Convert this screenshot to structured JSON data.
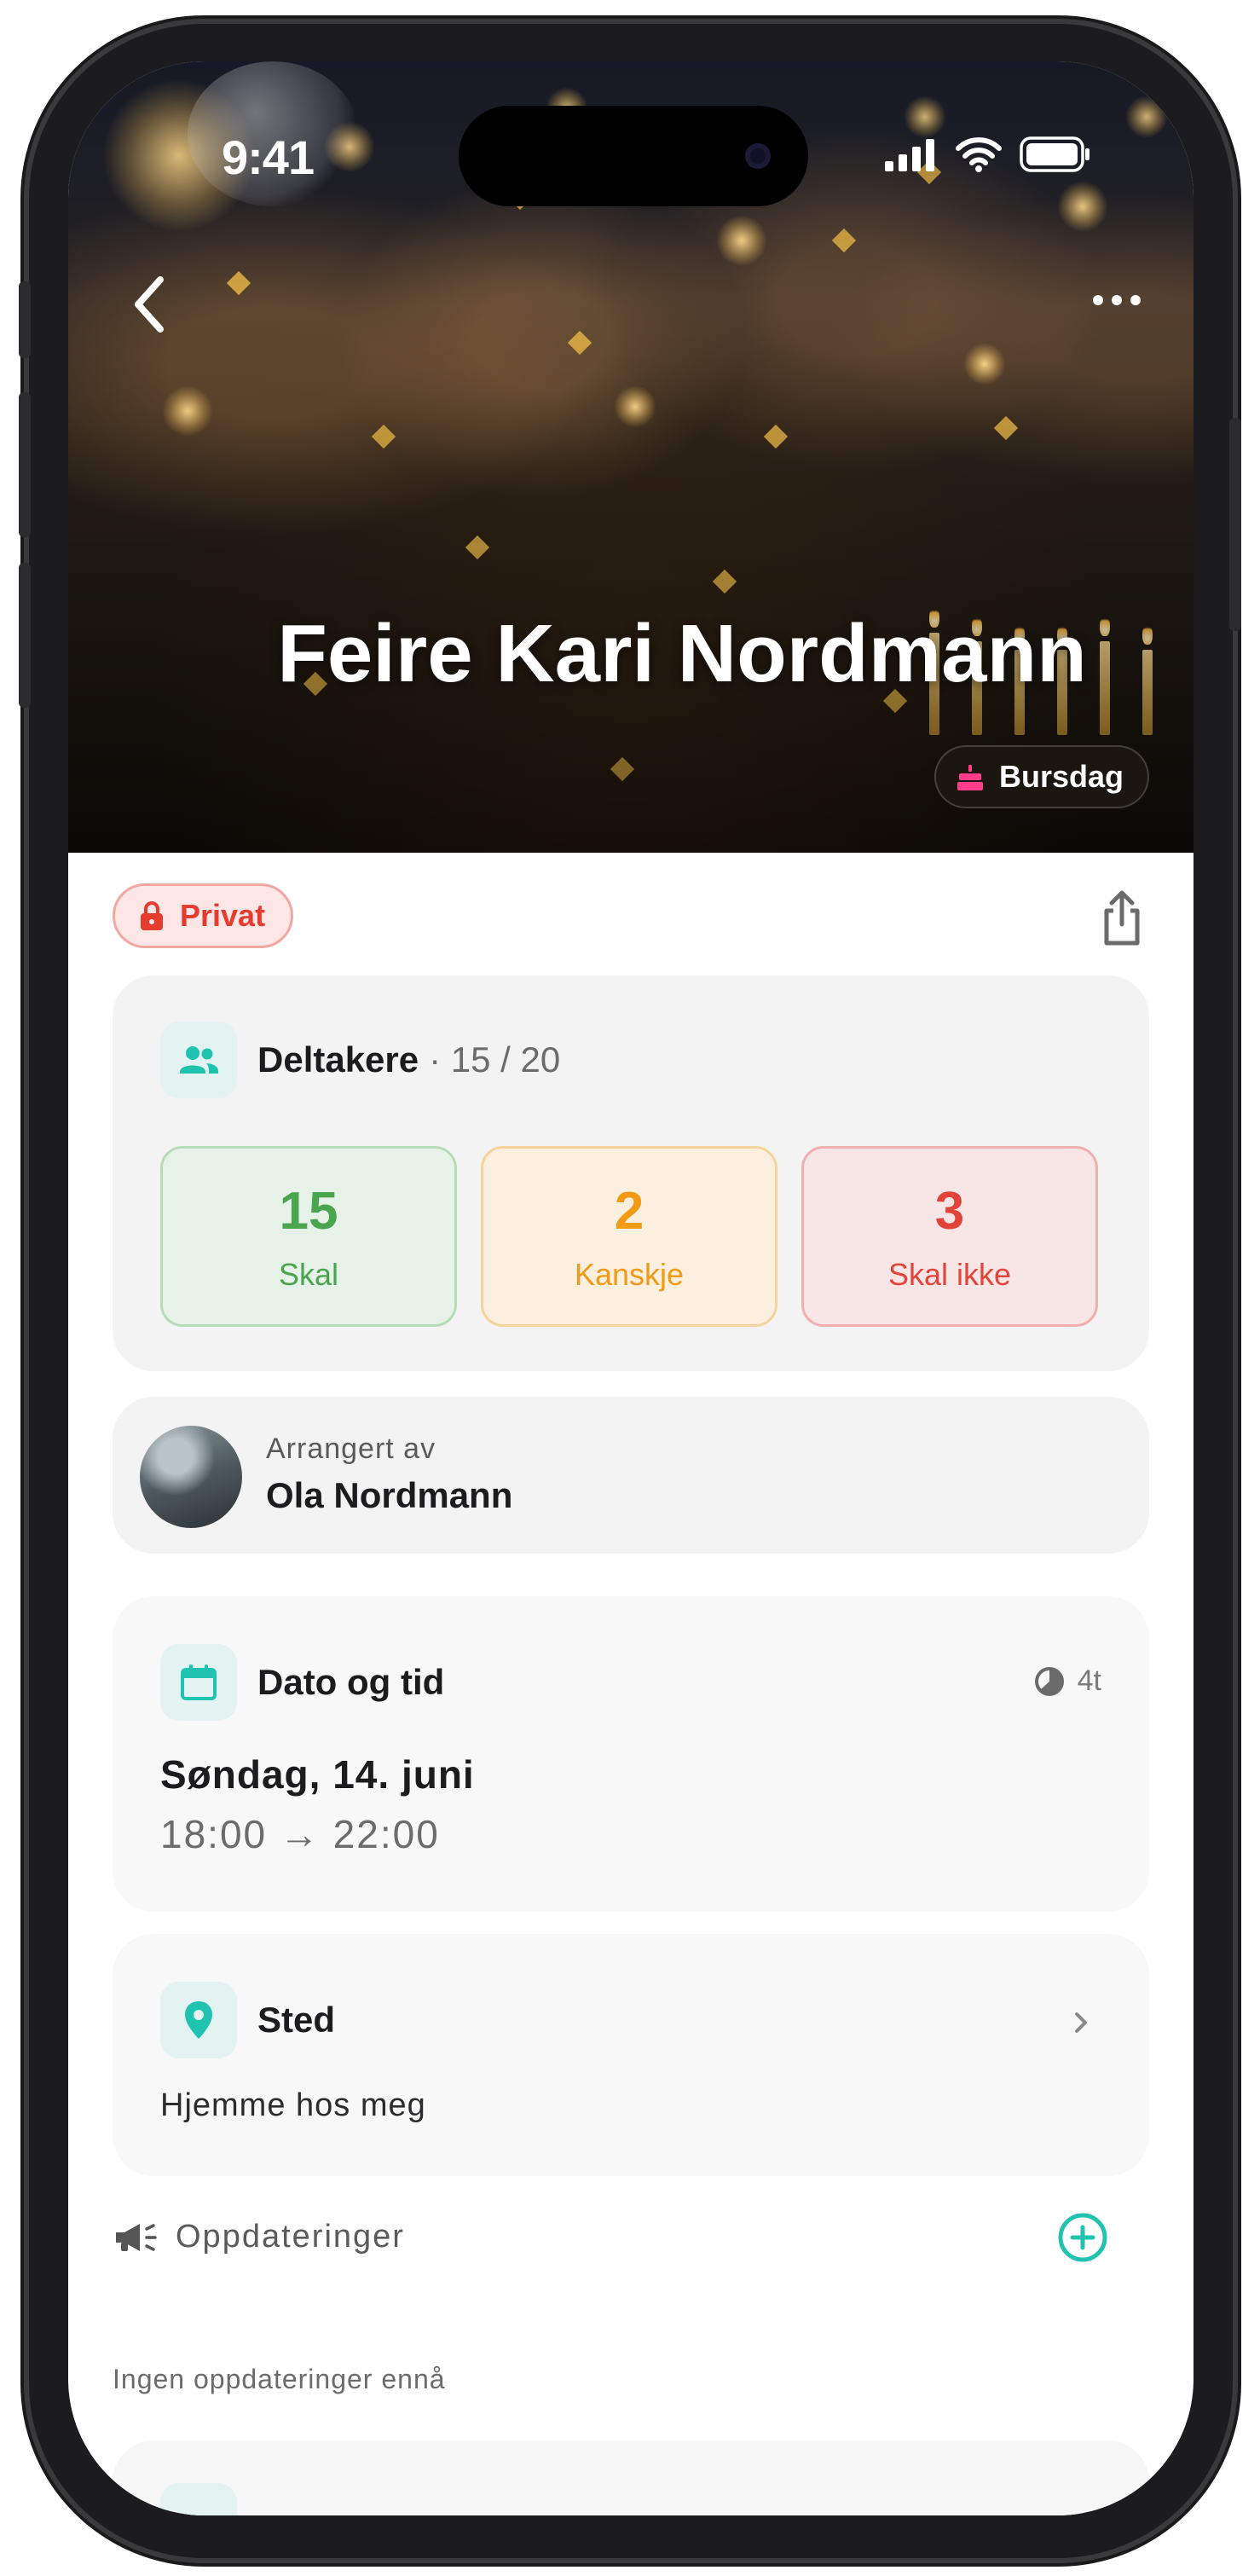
{
  "status_bar": {
    "time": "9:41"
  },
  "hero": {
    "title": "Feire Kari Nordmann",
    "category": "Bursdag"
  },
  "privacy": {
    "label": "Privat"
  },
  "participants": {
    "title": "Deltakere",
    "count": "· 15 / 20",
    "rsvp": [
      {
        "value": "15",
        "label": "Skal"
      },
      {
        "value": "2",
        "label": "Kanskje"
      },
      {
        "value": "3",
        "label": "Skal ikke"
      }
    ]
  },
  "organizer": {
    "label": "Arrangert av",
    "name": "Ola Nordmann"
  },
  "datetime": {
    "title": "Dato og tid",
    "duration": "4t",
    "date": "Søndag, 14. juni",
    "time": "18:00 → 22:00"
  },
  "location": {
    "title": "Sted",
    "value": "Hjemme hos meg"
  },
  "updates": {
    "title": "Oppdateringer",
    "empty": "Ingen oppdateringer ennå"
  },
  "colors": {
    "accent_teal": "#1fc3b0",
    "privacy_red": "#e53c2f",
    "rsvp_yes": "#4aa54f",
    "rsvp_maybe": "#f09a16",
    "rsvp_no": "#e2443a",
    "category_pink": "#ff3d8b"
  }
}
